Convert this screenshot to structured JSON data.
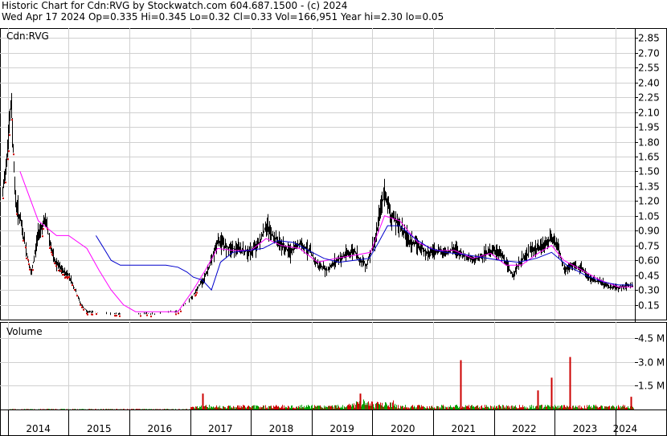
{
  "header": {
    "line1": "Historic Chart for Cdn:RVG by Stockwatch.com 604.687.1500 - (c) 2024",
    "line2": "Wed Apr 17 2024  Op=0.335  Hi=0.345  Lo=0.32  Cl=0.33  Vol=166,951  Year hi=2.30  lo=0.05"
  },
  "chart_data": [
    {
      "type": "line",
      "panel": "price",
      "label": "Cdn:RVG",
      "y_ticks": [
        "2.85",
        "2.70",
        "2.55",
        "2.40",
        "2.25",
        "2.10",
        "1.95",
        "1.80",
        "1.65",
        "1.50",
        "1.35",
        "1.20",
        "1.05",
        "0.90",
        "0.75",
        "0.60",
        "0.45",
        "0.30",
        "0.15"
      ],
      "ylim": [
        0.0,
        2.95
      ],
      "x_ticks": [
        "2014",
        "2015",
        "2016",
        "2017",
        "2018",
        "2019",
        "2020",
        "2021",
        "2022",
        "2023",
        "2024"
      ],
      "xlim": [
        2013.87,
        2024.32
      ],
      "colors": {
        "price": "#000000",
        "low": "#cc0000",
        "ma_short": "#ff00ff",
        "ma_long": "#0000cc"
      },
      "series": [
        {
          "role": "price",
          "x": [
            2013.9,
            2013.98,
            2014.05,
            2014.12,
            2014.2,
            2014.28,
            2014.38,
            2014.5,
            2014.62,
            2014.75,
            2014.88,
            2015.0,
            2015.1,
            2015.2,
            2015.3,
            2015.5,
            2015.7,
            2015.9,
            2016.2,
            2016.45,
            2016.55,
            2016.8,
            2017.05,
            2017.15,
            2017.25,
            2017.35,
            2017.45,
            2017.55,
            2017.7,
            2017.85,
            2018.0,
            2018.15,
            2018.25,
            2018.35,
            2018.5,
            2018.65,
            2018.8,
            2018.95,
            2019.1,
            2019.25,
            2019.4,
            2019.55,
            2019.7,
            2019.8,
            2019.9,
            2019.97,
            2020.05,
            2020.12,
            2020.2,
            2020.3,
            2020.45,
            2020.6,
            2020.75,
            2020.9,
            2021.05,
            2021.2,
            2021.35,
            2021.5,
            2021.65,
            2021.8,
            2021.95,
            2022.1,
            2022.2,
            2022.3,
            2022.45,
            2022.6,
            2022.75,
            2022.85,
            2022.95,
            2023.05,
            2023.15,
            2023.3,
            2023.45,
            2023.6,
            2023.75,
            2023.9,
            2024.05,
            2024.2,
            2024.29
          ],
          "y": [
            1.2,
            1.7,
            2.2,
            1.2,
            1.0,
            0.75,
            0.45,
            0.9,
            1.0,
            0.6,
            0.5,
            0.45,
            0.3,
            0.15,
            0.08,
            0.07,
            0.06,
            0.06,
            0.06,
            0.06,
            0.08,
            0.08,
            0.25,
            0.35,
            0.45,
            0.6,
            0.8,
            0.75,
            0.72,
            0.7,
            0.68,
            0.8,
            0.95,
            0.85,
            0.75,
            0.68,
            0.78,
            0.7,
            0.55,
            0.5,
            0.6,
            0.65,
            0.7,
            0.6,
            0.55,
            0.7,
            0.8,
            1.1,
            1.3,
            1.05,
            0.95,
            0.8,
            0.75,
            0.68,
            0.7,
            0.68,
            0.72,
            0.65,
            0.6,
            0.65,
            0.7,
            0.68,
            0.55,
            0.45,
            0.6,
            0.7,
            0.72,
            0.78,
            0.82,
            0.75,
            0.5,
            0.55,
            0.5,
            0.4,
            0.38,
            0.33,
            0.32,
            0.35,
            0.33
          ]
        },
        {
          "role": "ma_short",
          "x": [
            2014.2,
            2014.5,
            2014.8,
            2015.0,
            2015.3,
            2015.5,
            2015.7,
            2015.9,
            2016.1,
            2016.45,
            2016.8,
            2017.05,
            2017.25,
            2017.45,
            2017.7,
            2018.0,
            2018.25,
            2018.5,
            2018.8,
            2019.1,
            2019.4,
            2019.7,
            2019.97,
            2020.2,
            2020.45,
            2020.75,
            2021.05,
            2021.35,
            2021.65,
            2021.95,
            2022.2,
            2022.45,
            2022.75,
            2022.95,
            2023.15,
            2023.45,
            2023.75,
            2024.05,
            2024.29
          ],
          "y": [
            1.5,
            1.0,
            0.85,
            0.85,
            0.72,
            0.5,
            0.3,
            0.15,
            0.08,
            0.08,
            0.08,
            0.3,
            0.5,
            0.72,
            0.7,
            0.7,
            0.82,
            0.75,
            0.72,
            0.58,
            0.62,
            0.65,
            0.68,
            1.05,
            1.0,
            0.78,
            0.7,
            0.7,
            0.62,
            0.67,
            0.55,
            0.55,
            0.68,
            0.75,
            0.6,
            0.5,
            0.4,
            0.33,
            0.33
          ]
        },
        {
          "role": "ma_long",
          "x": [
            2015.45,
            2015.55,
            2015.7,
            2015.85,
            2016.0,
            2016.3,
            2016.6,
            2016.8,
            2016.95,
            2017.05,
            2017.2,
            2017.35,
            2017.5,
            2017.7,
            2017.95,
            2018.2,
            2018.45,
            2018.7,
            2018.95,
            2019.2,
            2019.45,
            2019.7,
            2019.95,
            2020.1,
            2020.25,
            2020.45,
            2020.7,
            2020.95,
            2021.2,
            2021.5,
            2021.8,
            2022.1,
            2022.4,
            2022.7,
            2022.95,
            2023.2,
            2023.5,
            2023.8,
            2024.05,
            2024.29
          ],
          "y": [
            0.85,
            0.75,
            0.6,
            0.55,
            0.55,
            0.55,
            0.55,
            0.53,
            0.48,
            0.43,
            0.4,
            0.3,
            0.58,
            0.68,
            0.7,
            0.72,
            0.8,
            0.78,
            0.7,
            0.62,
            0.58,
            0.6,
            0.62,
            0.78,
            0.95,
            0.95,
            0.82,
            0.72,
            0.68,
            0.66,
            0.63,
            0.6,
            0.58,
            0.62,
            0.68,
            0.55,
            0.45,
            0.38,
            0.35,
            0.35
          ]
        }
      ]
    },
    {
      "type": "bar",
      "panel": "volume",
      "label": "Volume",
      "y_ticks": [
        "4.5 M",
        "3.0 M",
        "1.5 M"
      ],
      "ylim": [
        0,
        5.5
      ],
      "unit": "M",
      "colors": {
        "up": "#00a000",
        "down": "#cc0000"
      },
      "spikes": [
        {
          "x": 2017.2,
          "value": 1.0
        },
        {
          "x": 2019.8,
          "value": 1.0
        },
        {
          "x": 2021.45,
          "value": 3.1
        },
        {
          "x": 2022.72,
          "value": 1.2
        },
        {
          "x": 2022.95,
          "value": 2.0
        },
        {
          "x": 2023.25,
          "value": 3.3
        },
        {
          "x": 2024.25,
          "value": 0.8
        }
      ]
    }
  ]
}
